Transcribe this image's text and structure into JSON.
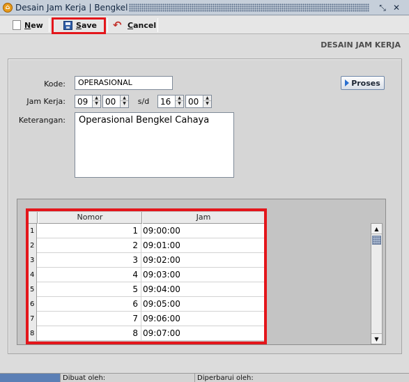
{
  "window": {
    "title": "Desain Jam Kerja | Bengkel"
  },
  "toolbar": {
    "new_label": "New",
    "save_label": "Save",
    "cancel_label": "Cancel"
  },
  "page": {
    "heading": "DESAIN JAM KERJA"
  },
  "form": {
    "kode_label": "Kode:",
    "kode_value": "OPERASIONAL",
    "jam_kerja_label": "Jam Kerja:",
    "start_hour": "09",
    "start_minute": "00",
    "sd_label": "s/d",
    "end_hour": "16",
    "end_minute": "00",
    "keterangan_label": "Keterangan:",
    "keterangan_value": "Operasional Bengkel Cahaya",
    "proses_label": "Proses"
  },
  "grid": {
    "columns": [
      "Nomor",
      "Jam"
    ],
    "rows": [
      {
        "header": "1",
        "nomor": "1",
        "jam": "09:00:00"
      },
      {
        "header": "2",
        "nomor": "2",
        "jam": "09:01:00"
      },
      {
        "header": "3",
        "nomor": "3",
        "jam": "09:02:00"
      },
      {
        "header": "4",
        "nomor": "4",
        "jam": "09:03:00"
      },
      {
        "header": "5",
        "nomor": "5",
        "jam": "09:04:00"
      },
      {
        "header": "6",
        "nomor": "6",
        "jam": "09:05:00"
      },
      {
        "header": "7",
        "nomor": "7",
        "jam": "09:06:00"
      },
      {
        "header": "8",
        "nomor": "8",
        "jam": "09:07:00"
      }
    ]
  },
  "status": {
    "created_by_label": "Dibuat oleh:",
    "updated_by_label": "Diperbarui oleh:"
  },
  "colors": {
    "highlight": "#e3161b",
    "titlebar": "#c6cfda"
  }
}
